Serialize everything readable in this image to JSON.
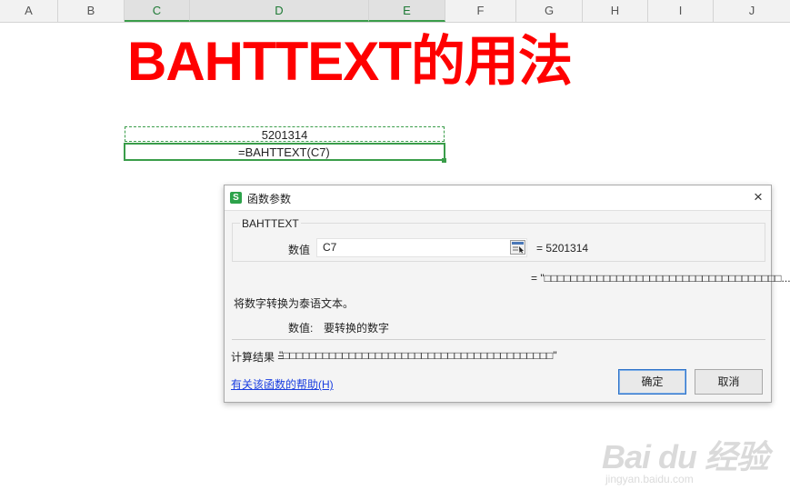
{
  "sheet": {
    "columns": [
      "A",
      "B",
      "C",
      "D",
      "E",
      "F",
      "G",
      "H",
      "I",
      "J"
    ],
    "selected_columns": [
      "C",
      "D",
      "E"
    ],
    "title_text": "BAHTTEXT的用法",
    "cell_value": "5201314",
    "cell_formula": "=BAHTTEXT(C7)"
  },
  "dialog": {
    "title": "函数参数",
    "function_name": "BAHTTEXT",
    "arg_label": "数值",
    "arg_value": "C7",
    "arg_result": "=  5201314",
    "function_result": "=  \"□□□□□□□□□□□□□□□□□□□□□□□□□□□□□□□□□□□□...",
    "description": "将数字转换为泰语文本。",
    "param_name": "数值:",
    "param_desc": "要转换的数字",
    "calc_label": "计算结果  =",
    "calc_value": "\"□□□□□□□□□□□□□□□□□□□□□□□□□□□□□□□□□□□□□□□□□\"",
    "help_link": "有关该函数的帮助(H)",
    "ok_label": "确定",
    "cancel_label": "取消",
    "close_label": "×"
  },
  "watermark": {
    "brand": "Bai du 经验",
    "url": "jingyan.baidu.com"
  },
  "colors": {
    "title_red": "#ff0000",
    "selection_green": "#3a9d4a",
    "link_blue": "#1a3ee0",
    "app_icon_green": "#2ca24a"
  },
  "icons": [
    "wps-logo-icon",
    "close-icon",
    "range-select-icon"
  ]
}
